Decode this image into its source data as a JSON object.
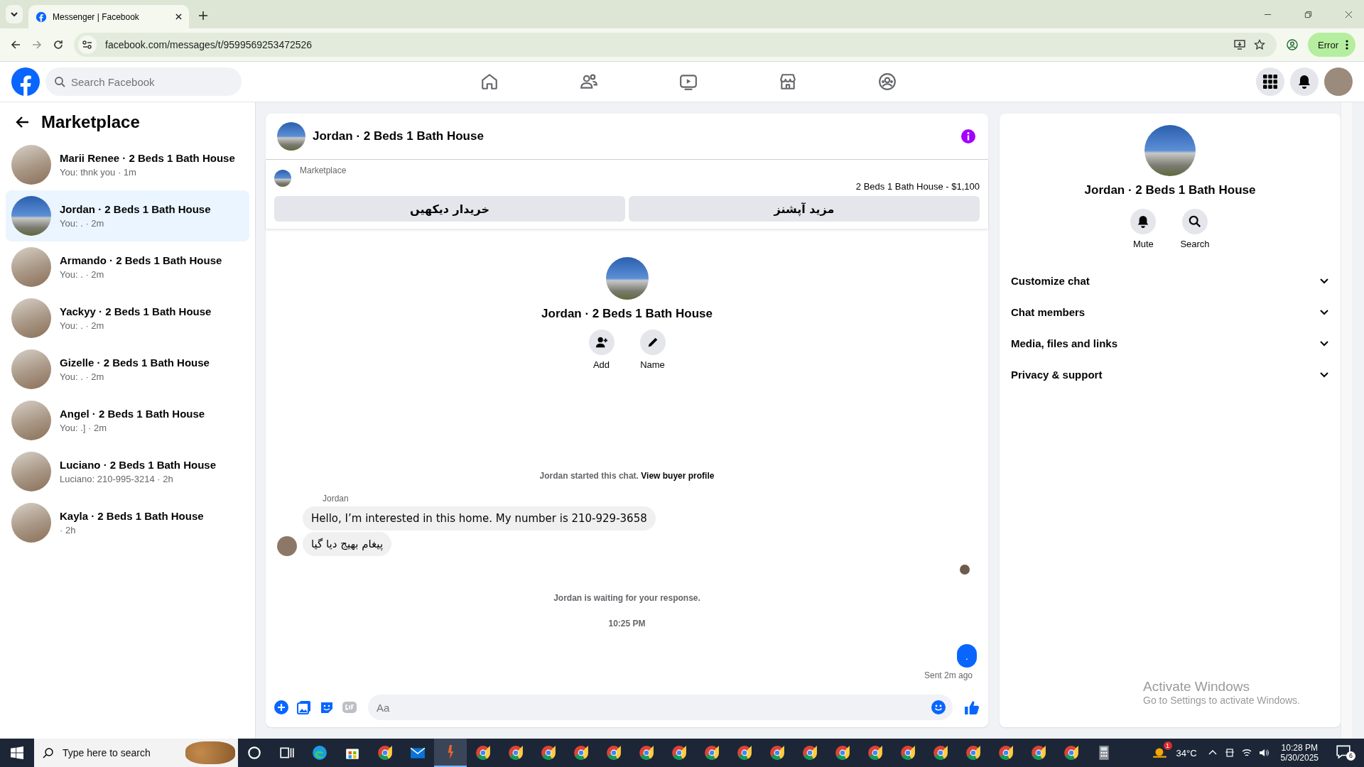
{
  "browser": {
    "tab_title": "Messenger | Facebook",
    "url": "facebook.com/messages/t/9599569253472526",
    "profile_button": "Error"
  },
  "header": {
    "search_placeholder": "Search Facebook"
  },
  "sidebar": {
    "title": "Marketplace",
    "conversations": [
      {
        "name": "Marii Renee · 2 Beds 1 Bath House",
        "preview": "You: thnk you · 1m",
        "selected": false,
        "kind": "interior"
      },
      {
        "name": "Jordan · 2 Beds 1 Bath House",
        "preview": "You: . · 2m",
        "selected": true,
        "kind": "exterior"
      },
      {
        "name": "Armando · 2 Beds 1 Bath House",
        "preview": "You: . · 2m",
        "selected": false,
        "kind": "interior"
      },
      {
        "name": "Yackyy · 2 Beds 1 Bath House",
        "preview": "You: . · 2m",
        "selected": false,
        "kind": "interior"
      },
      {
        "name": "Gizelle · 2 Beds 1 Bath House",
        "preview": "You: . · 2m",
        "selected": false,
        "kind": "interior"
      },
      {
        "name": "Angel · 2 Beds 1 Bath House",
        "preview": "You: .] · 2m",
        "selected": false,
        "kind": "interior"
      },
      {
        "name": "Luciano · 2 Beds 1 Bath House",
        "preview": "Luciano: 210-995-3214 · 2h",
        "selected": false,
        "kind": "interior"
      },
      {
        "name": "Kayla · 2 Beds 1 Bath House",
        "preview": "· 2h",
        "selected": false,
        "kind": "interior"
      }
    ]
  },
  "chat": {
    "title": "Jordan · 2 Beds 1 Bath House",
    "listing": {
      "label": "Marketplace",
      "summary": "2 Beds 1 Bath House - $1,100",
      "buttons": [
        "مزید آپشنز",
        "خریدار دیکھیں"
      ]
    },
    "intro": {
      "name": "Jordan · 2 Beds 1 Bath House",
      "actions": [
        {
          "kind": "add",
          "label": "Add"
        },
        {
          "kind": "name",
          "label": "Name"
        }
      ]
    },
    "notice": {
      "text": "Jordan started this chat.",
      "link": "View buyer profile"
    },
    "messages": [
      {
        "kind": "sender",
        "text": "Jordan"
      },
      {
        "kind": "incoming",
        "text": "Hello, I’m interested in this home. My number is 210-929-3658",
        "avatar": false
      },
      {
        "kind": "incoming",
        "text": "پیغام بھیج دیا گیا",
        "avatar": true
      },
      {
        "kind": "seen"
      },
      {
        "kind": "status",
        "text": "Jordan is waiting for your response."
      },
      {
        "kind": "time",
        "text": "10:25 PM"
      },
      {
        "kind": "outgoing",
        "text": "."
      },
      {
        "kind": "delivery",
        "text": "Sent 2m ago"
      }
    ],
    "composer": {
      "placeholder": "Aa"
    }
  },
  "details": {
    "name": "Jordan · 2 Beds 1 Bath House",
    "actions": [
      {
        "kind": "mute",
        "label": "Mute"
      },
      {
        "kind": "search",
        "label": "Search"
      }
    ],
    "sections": [
      {
        "label": "Customize chat",
        "expanded": false
      },
      {
        "label": "Chat members",
        "expanded": false
      },
      {
        "label": "Media, files and links",
        "expanded": false
      },
      {
        "label": "Privacy & support",
        "expanded": false
      }
    ]
  },
  "activation_notice": {
    "title": "Activate Windows",
    "text": "Go to Settings to activate Windows."
  },
  "taskbar": {
    "search_placeholder": "Type here to search",
    "weather_badge": "1",
    "temperature": "34°C",
    "time": "10:28 PM",
    "date": "5/30/2025",
    "notification_count": "6"
  }
}
